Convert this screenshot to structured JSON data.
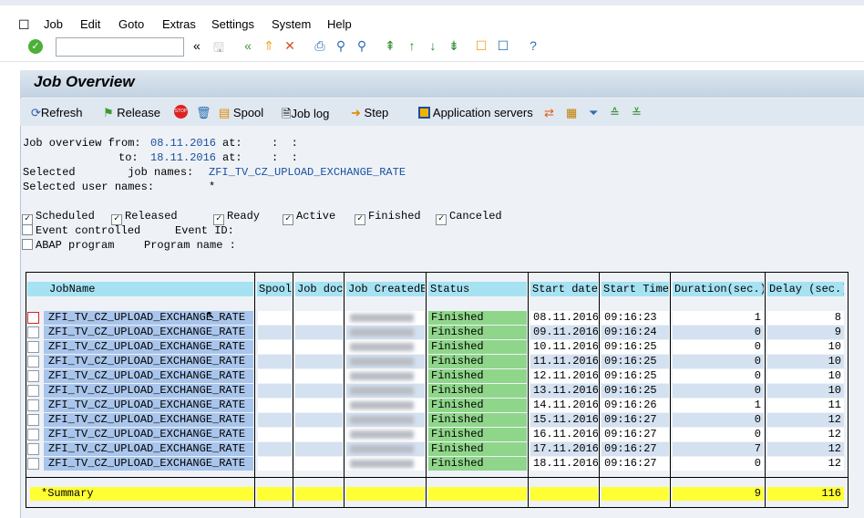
{
  "menu": [
    "Job",
    "Edit",
    "Goto",
    "Extras",
    "Settings",
    "System",
    "Help"
  ],
  "toolbar_icons": [
    "check-icon",
    "back-icon",
    "exit-icon",
    "cancel-icon",
    "print-icon",
    "find-icon",
    "find-next-icon",
    "first-page-icon",
    "previous-page-icon",
    "next-page-icon",
    "last-page-icon",
    "new-session-icon",
    "shortcut-icon",
    "help-icon",
    "customize-layout-icon"
  ],
  "title": "Job Overview",
  "app_toolbar": {
    "refresh": "Refresh",
    "release": "Release",
    "spool": "Spool",
    "job_log": "Job log",
    "step": "Step",
    "app_servers": "Application servers"
  },
  "criteria": {
    "from_label": "Job overview from:",
    "from_date": "08.11.2016",
    "at1": "at:",
    "from_time": ":  :",
    "to_label": "to:",
    "to_date": "18.11.2016",
    "at2": "at:",
    "to_time": ":  :",
    "job_names_label": "Selected        job names:",
    "job_names": "ZFI_TV_CZ_UPLOAD_EXCHANGE_RATE",
    "user_names_label": "Selected user names:",
    "user_names": "*"
  },
  "status_filters": [
    {
      "label": "Scheduled",
      "checked": true
    },
    {
      "label": "Released",
      "checked": true
    },
    {
      "label": "Ready",
      "checked": true
    },
    {
      "label": "Active",
      "checked": true
    },
    {
      "label": "Finished",
      "checked": true
    },
    {
      "label": "Canceled",
      "checked": true
    }
  ],
  "event": {
    "label": "Event controlled",
    "checked": false,
    "id_label": "Event ID:"
  },
  "abap": {
    "label": "ABAP program",
    "checked": false,
    "name_label": "Program name :"
  },
  "table": {
    "headers": [
      "JobName",
      "Spool",
      "Job doc",
      "Job CreatedB",
      "Status",
      "Start date",
      "Start Time",
      "Duration(sec.)",
      "Delay (sec.)"
    ],
    "rows": [
      [
        "ZFI_TV_CZ_UPLOAD_EXCHANGE_RATE",
        "Finished",
        "08.11.2016",
        "09:16:23",
        "1",
        "8"
      ],
      [
        "ZFI_TV_CZ_UPLOAD_EXCHANGE_RATE",
        "Finished",
        "09.11.2016",
        "09:16:24",
        "0",
        "9"
      ],
      [
        "ZFI_TV_CZ_UPLOAD_EXCHANGE_RATE",
        "Finished",
        "10.11.2016",
        "09:16:25",
        "0",
        "10"
      ],
      [
        "ZFI_TV_CZ_UPLOAD_EXCHANGE_RATE",
        "Finished",
        "11.11.2016",
        "09:16:25",
        "0",
        "10"
      ],
      [
        "ZFI_TV_CZ_UPLOAD_EXCHANGE_RATE",
        "Finished",
        "12.11.2016",
        "09:16:25",
        "0",
        "10"
      ],
      [
        "ZFI_TV_CZ_UPLOAD_EXCHANGE_RATE",
        "Finished",
        "13.11.2016",
        "09:16:25",
        "0",
        "10"
      ],
      [
        "ZFI_TV_CZ_UPLOAD_EXCHANGE_RATE",
        "Finished",
        "14.11.2016",
        "09:16:26",
        "1",
        "11"
      ],
      [
        "ZFI_TV_CZ_UPLOAD_EXCHANGE_RATE",
        "Finished",
        "15.11.2016",
        "09:16:27",
        "0",
        "12"
      ],
      [
        "ZFI_TV_CZ_UPLOAD_EXCHANGE_RATE",
        "Finished",
        "16.11.2016",
        "09:16:27",
        "0",
        "12"
      ],
      [
        "ZFI_TV_CZ_UPLOAD_EXCHANGE_RATE",
        "Finished",
        "17.11.2016",
        "09:16:27",
        "7",
        "12"
      ],
      [
        "ZFI_TV_CZ_UPLOAD_EXCHANGE_RATE",
        "Finished",
        "18.11.2016",
        "09:16:27",
        "0",
        "12"
      ]
    ],
    "summary": {
      "label": "*Summary",
      "duration": "9",
      "delay": "116"
    }
  },
  "colors": {
    "header": "#a6e2f2",
    "jobname": "#a9c5eb",
    "status_finished": "#8fd68a",
    "summary": "#ffff33"
  }
}
